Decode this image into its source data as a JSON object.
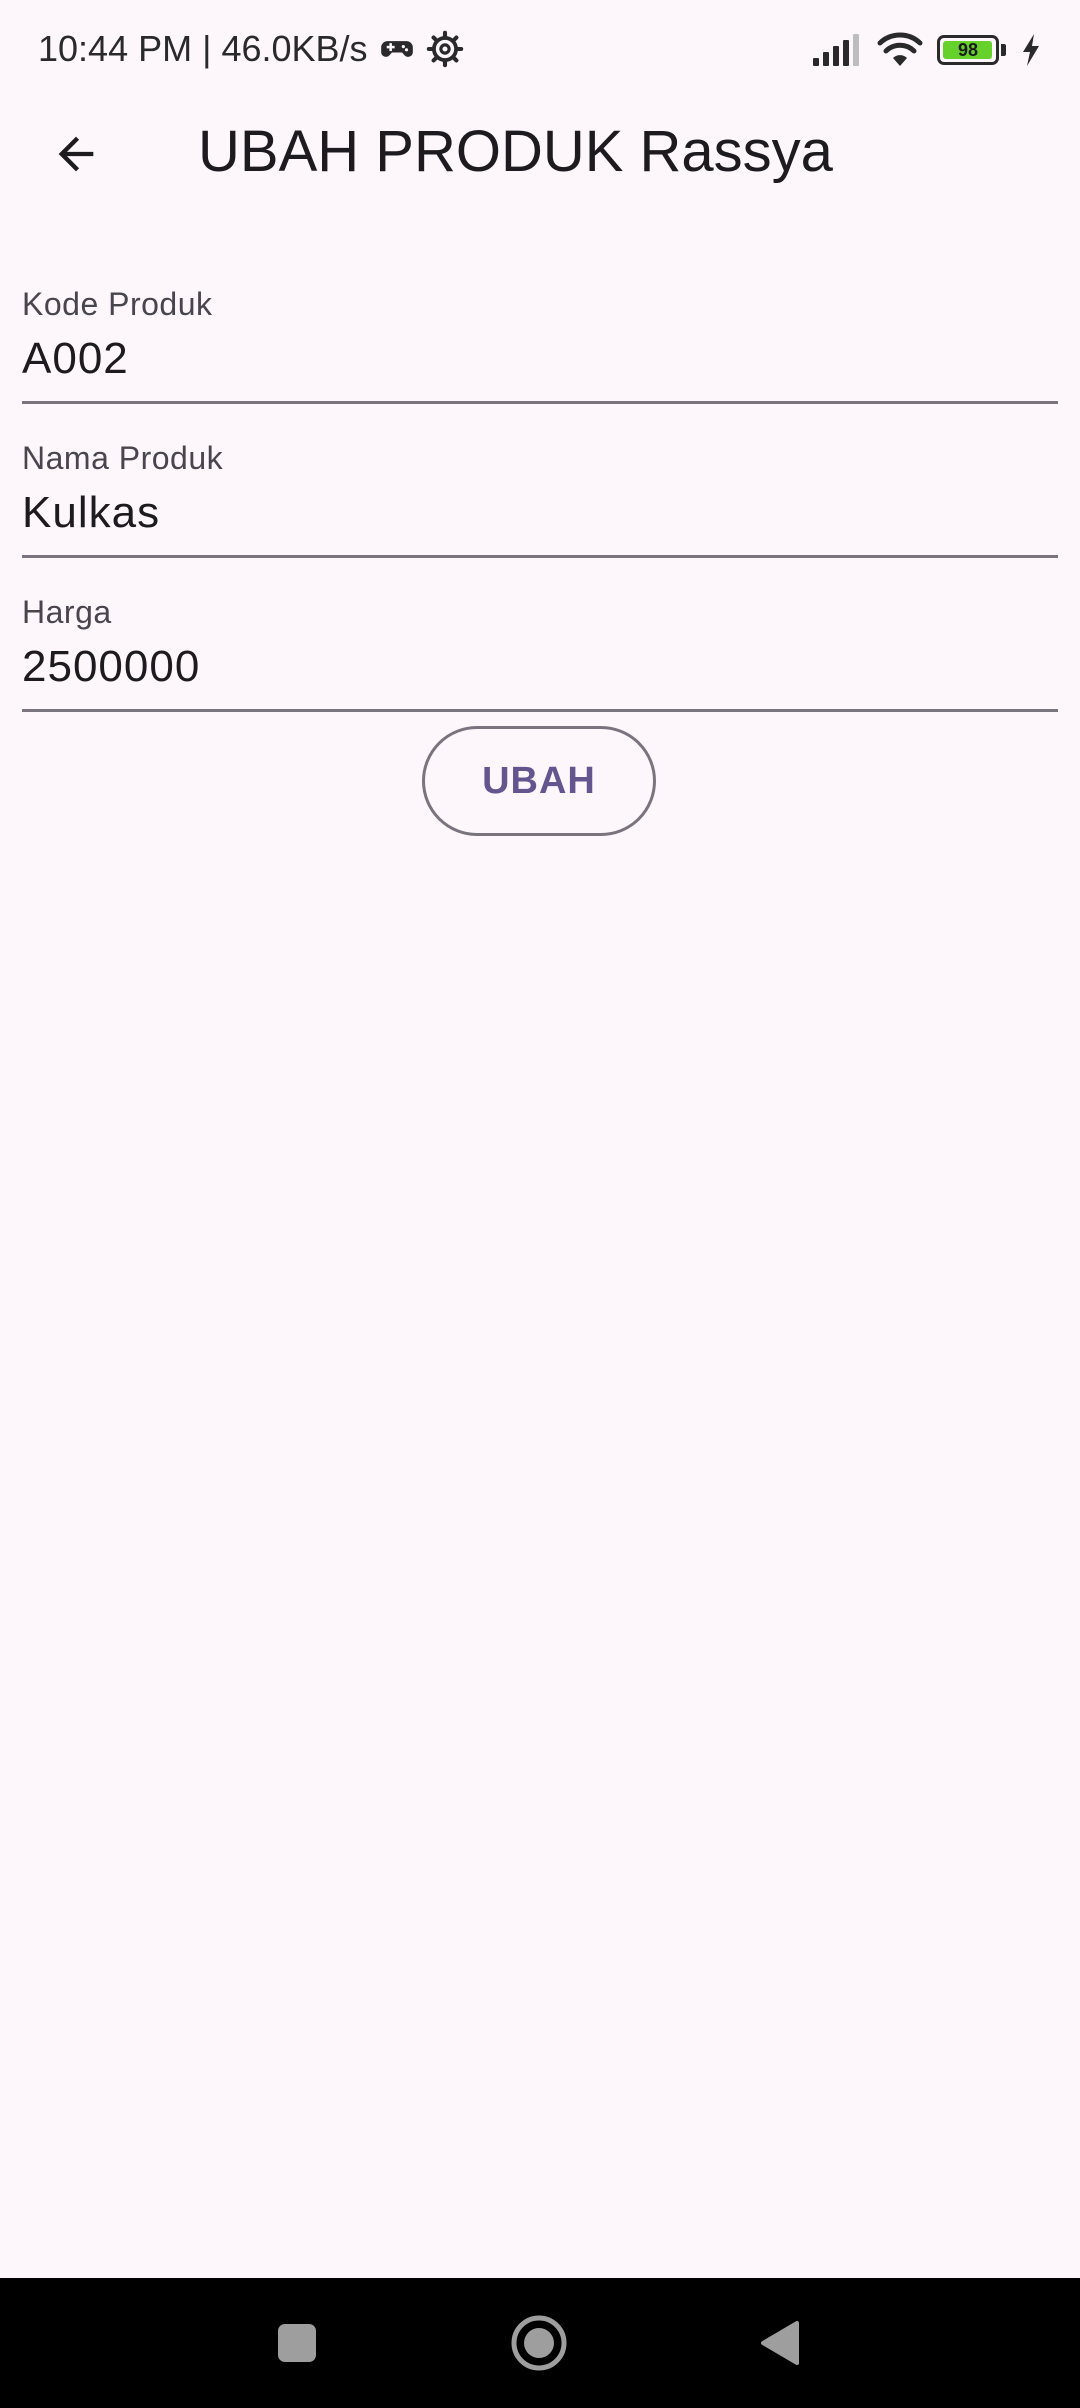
{
  "status_bar": {
    "time_speed": "10:44 PM | 46.0KB/s",
    "icons": [
      "game-controller-icon",
      "settings-icon",
      "signal-icon",
      "wifi-icon",
      "battery-icon",
      "charging-icon"
    ],
    "battery_level": "98",
    "battery_fraction": 0.98
  },
  "app_bar": {
    "title": "UBAH PRODUK Rassya",
    "back_icon": "arrow-back-icon"
  },
  "form": {
    "fields": [
      {
        "label": "Kode Produk",
        "value": "A002"
      },
      {
        "label": "Nama Produk",
        "value": "Kulkas"
      },
      {
        "label": "Harga",
        "value": "2500000"
      }
    ],
    "submit_label": "UBAH"
  },
  "nav_bar": {
    "buttons": [
      "recents-icon",
      "home-icon",
      "back-icon"
    ]
  },
  "colors": {
    "background": "#fdf7fc",
    "accent": "#65558f",
    "outline": "#79747e",
    "battery_fill": "#67d12b"
  }
}
